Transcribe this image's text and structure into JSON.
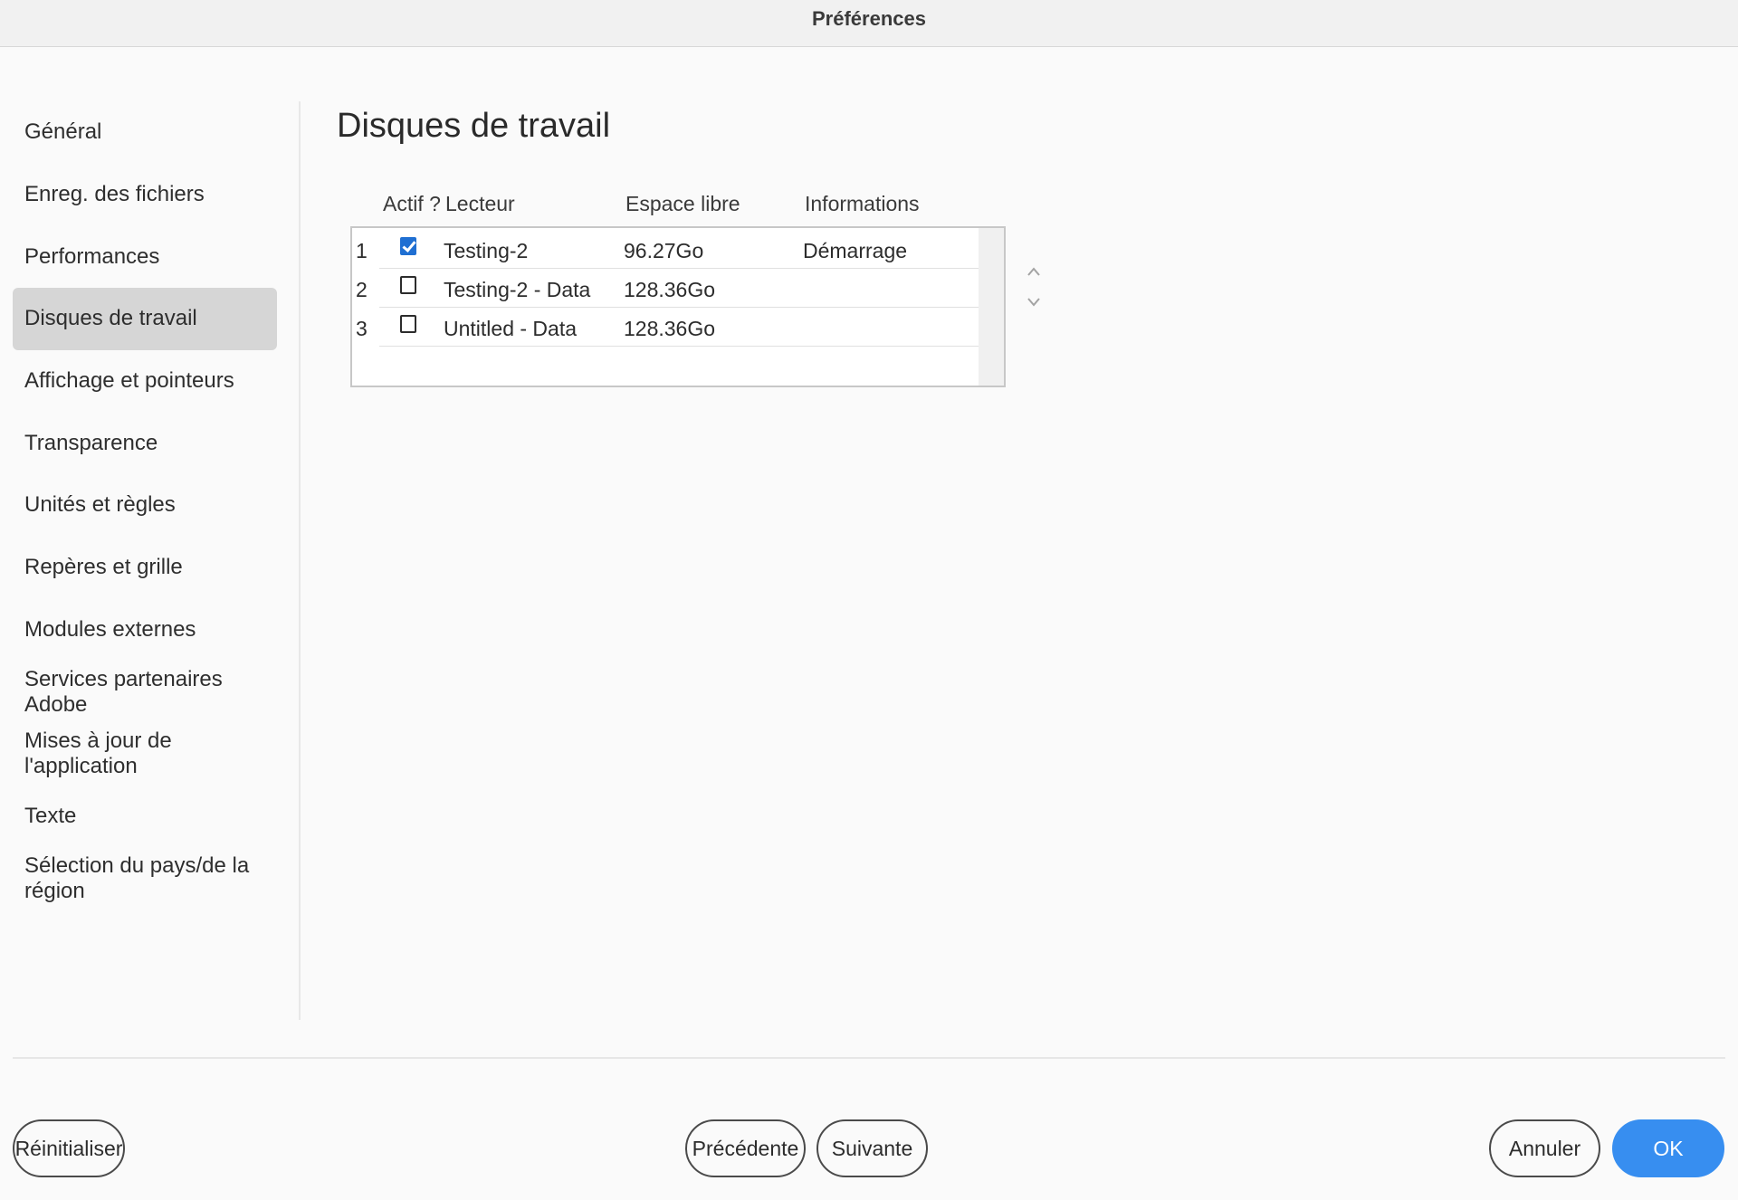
{
  "window": {
    "title": "Préférences"
  },
  "sidebar": {
    "items": [
      {
        "label": "Général",
        "active": false
      },
      {
        "label": "Enreg. des fichiers",
        "active": false
      },
      {
        "label": "Performances",
        "active": false
      },
      {
        "label": "Disques de travail",
        "active": true
      },
      {
        "label": "Affichage et pointeurs",
        "active": false
      },
      {
        "label": "Transparence",
        "active": false
      },
      {
        "label": "Unités et règles",
        "active": false
      },
      {
        "label": "Repères et grille",
        "active": false
      },
      {
        "label": "Modules externes",
        "active": false
      },
      {
        "label": "Services partenaires Adobe",
        "active": false
      },
      {
        "label": "Mises à jour de l'application",
        "active": false
      },
      {
        "label": "Texte",
        "active": false
      },
      {
        "label": "Sélection du pays/de la région",
        "active": false
      }
    ]
  },
  "main": {
    "title": "Disques de travail",
    "table": {
      "headers": {
        "active": "Actif ?",
        "drive": "Lecteur",
        "free_space": "Espace libre",
        "info": "Informations"
      },
      "rows": [
        {
          "index": "1",
          "active": true,
          "drive": "Testing-2",
          "free_space": "96.27Go",
          "info": "Démarrage"
        },
        {
          "index": "2",
          "active": false,
          "drive": "Testing-2 - Data",
          "free_space": "128.36Go",
          "info": ""
        },
        {
          "index": "3",
          "active": false,
          "drive": "Untitled - Data",
          "free_space": "128.36Go",
          "info": ""
        }
      ]
    },
    "move_up_icon": "chevron-up-icon",
    "move_down_icon": "chevron-down-icon"
  },
  "footer": {
    "reset_label": "Réinitialiser",
    "previous_label": "Précédente",
    "next_label": "Suivante",
    "cancel_label": "Annuler",
    "ok_label": "OK"
  },
  "colors": {
    "accent": "#378ef0",
    "checkbox_checked": "#1f6fd2",
    "sidebar_active": "#d6d6d6"
  }
}
